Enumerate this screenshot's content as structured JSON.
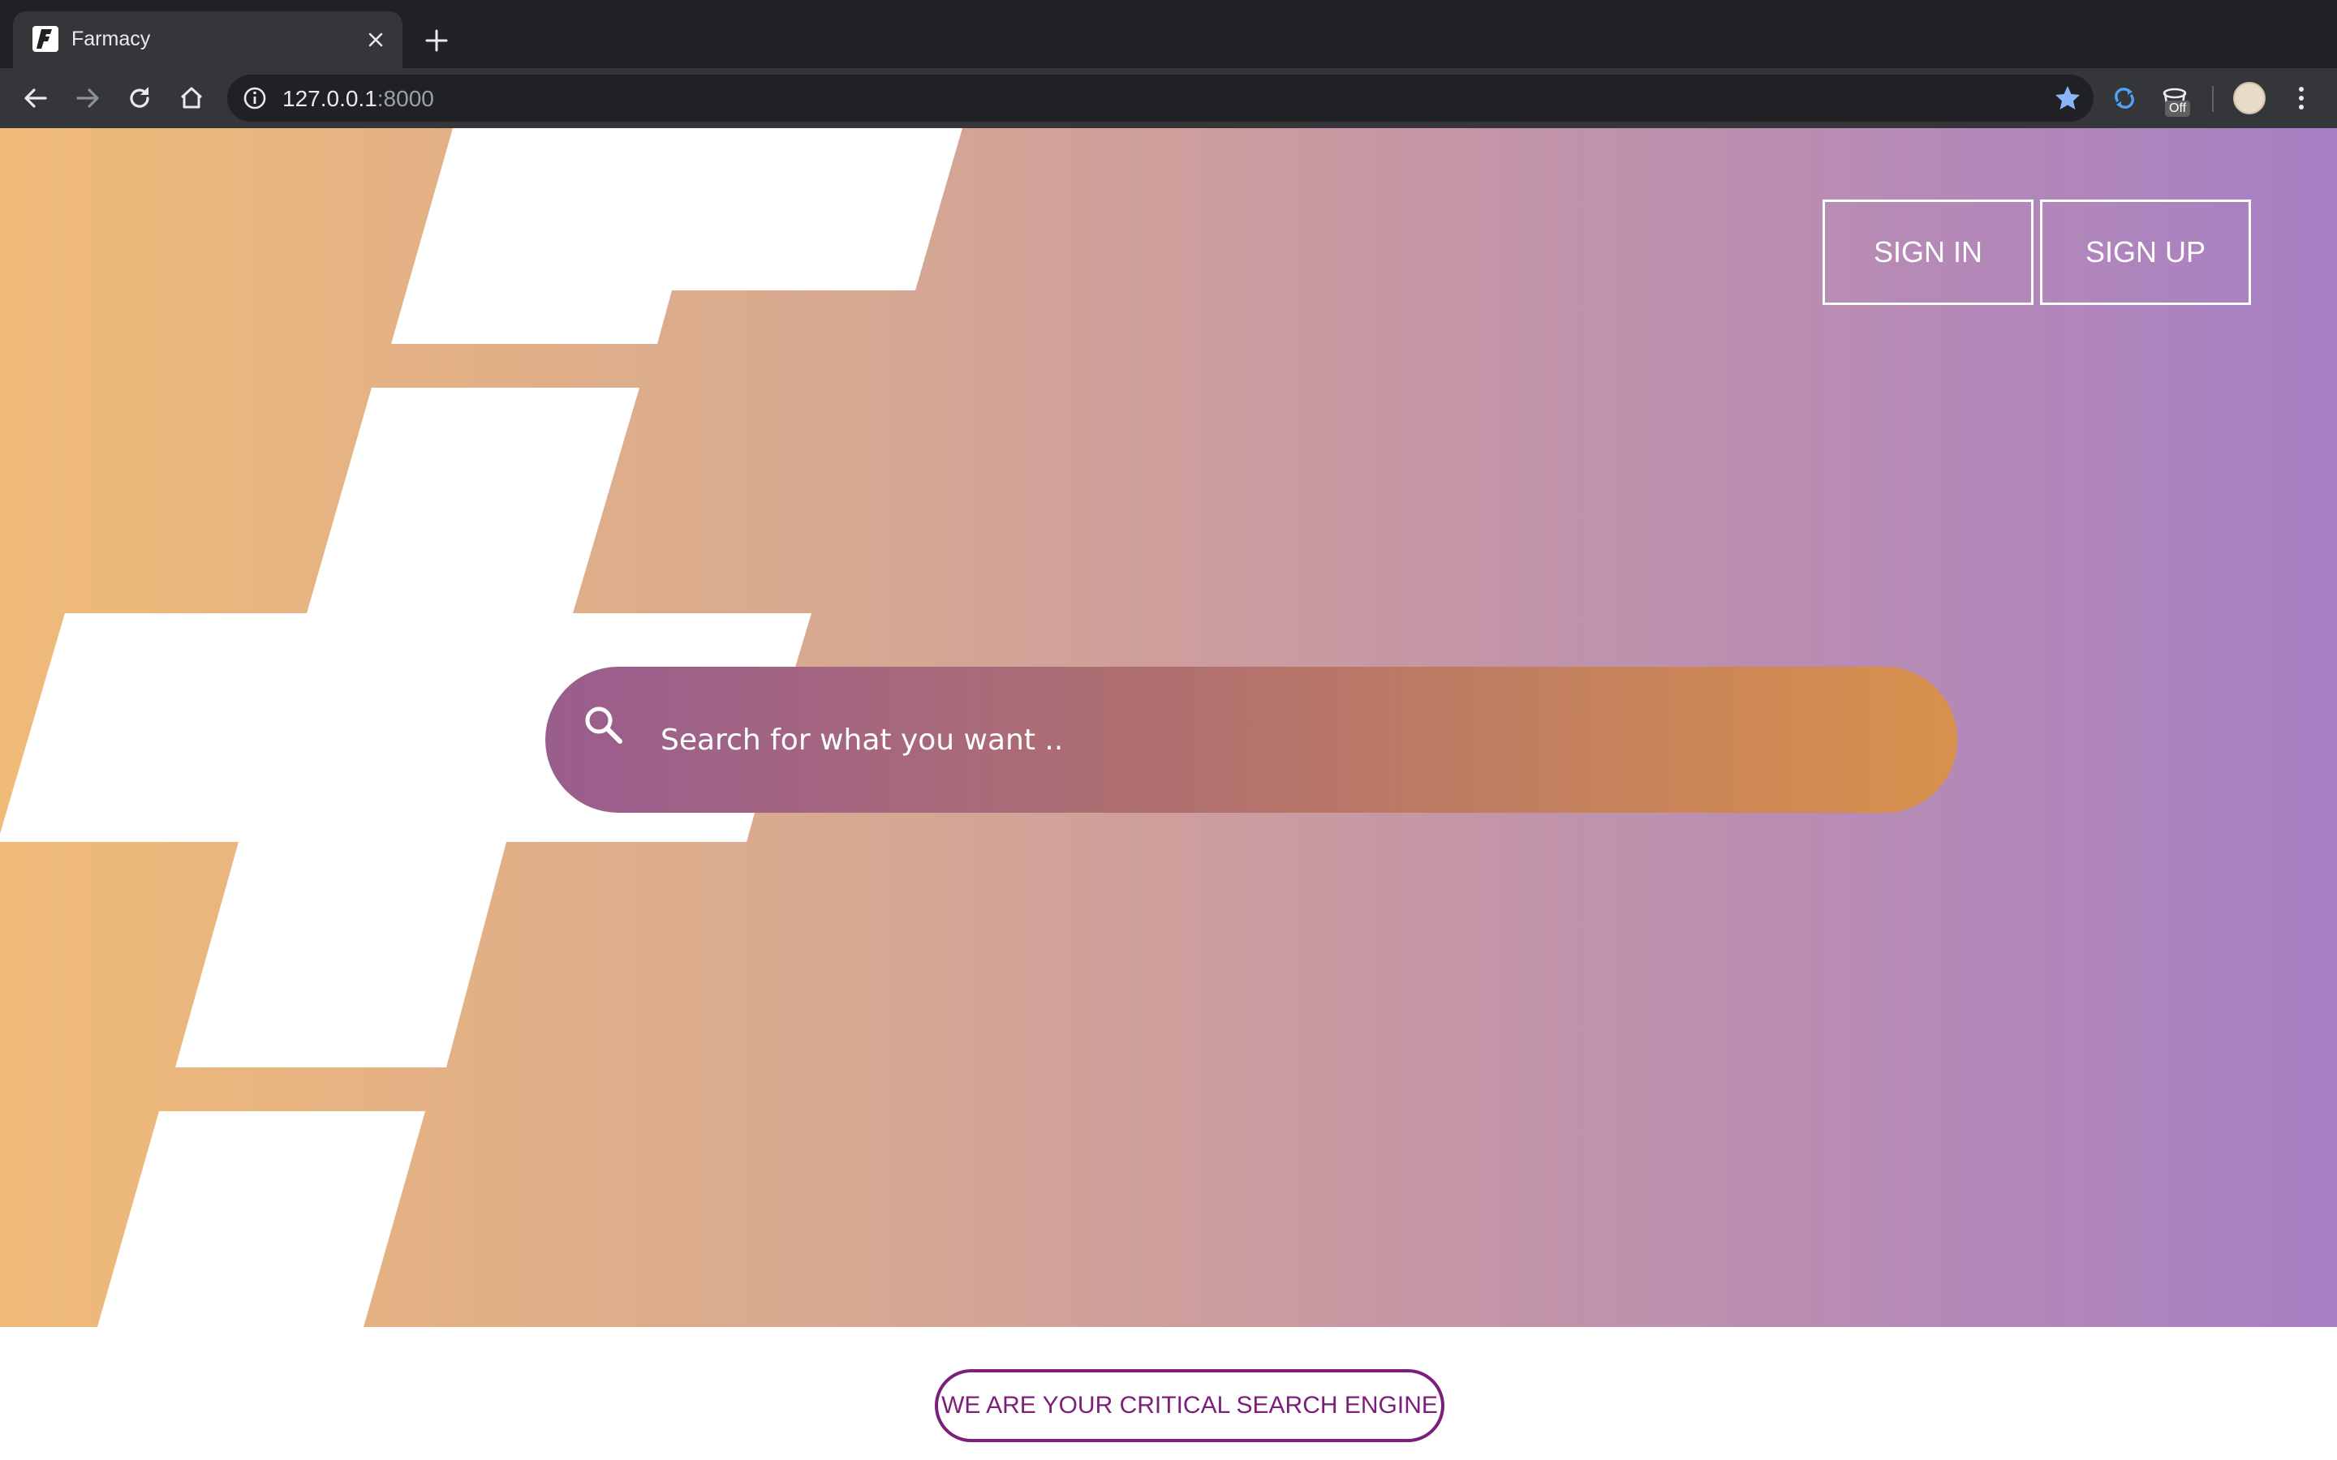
{
  "browser": {
    "tab_title": "Farmacy",
    "url_host": "127.0.0.1",
    "url_port": ":8000",
    "extension_badge": "Off"
  },
  "nav": {
    "sign_in_label": "SIGN IN",
    "sign_up_label": "SIGN UP"
  },
  "search": {
    "placeholder": "Search for what you want .."
  },
  "tagline": "WE ARE YOUR CRITICAL SEARCH ENGINE",
  "colors": {
    "gradient_start": "#f0bb78",
    "gradient_end": "#a77fc4",
    "search_start": "#9a5d8e",
    "search_end": "#d8914c",
    "tagline_purple": "#7b1f7b"
  }
}
